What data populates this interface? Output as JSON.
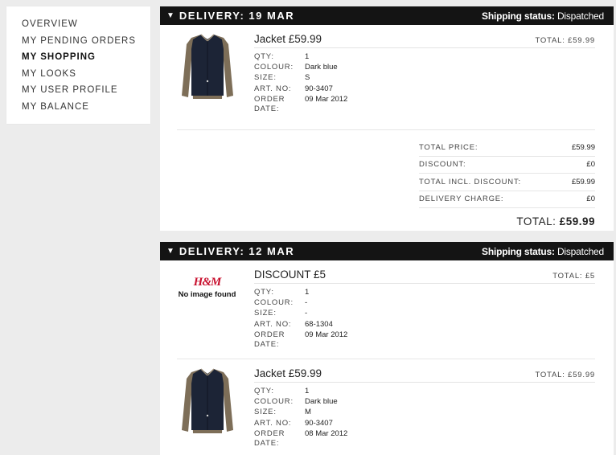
{
  "sidebar": {
    "items": [
      {
        "label": "OVERVIEW"
      },
      {
        "label": "MY PENDING ORDERS"
      },
      {
        "label": "MY SHOPPING",
        "active": true
      },
      {
        "label": "MY LOOKS"
      },
      {
        "label": "MY USER PROFILE"
      },
      {
        "label": "MY BALANCE"
      }
    ]
  },
  "labels": {
    "qty": "QTY:",
    "colour": "COLOUR:",
    "size": "SIZE:",
    "art_no": "ART. NO:",
    "order_date": "ORDER DATE:",
    "total": "TOTAL:",
    "shipping_status": "Shipping status:",
    "no_image": "No image found",
    "logo_text": "H&M"
  },
  "deliveries": [
    {
      "title": "DELIVERY: 19 MAR",
      "status": "Dispatched",
      "items": [
        {
          "name": "Jacket £59.99",
          "total": "£59.99",
          "qty": "1",
          "colour": "Dark blue",
          "size": "S",
          "art_no": "90-3407",
          "order_date": "09 Mar 2012"
        }
      ],
      "summary": [
        {
          "label": "TOTAL PRICE:",
          "value": "£59.99"
        },
        {
          "label": "DISCOUNT:",
          "value": "£0"
        },
        {
          "label": "TOTAL INCL. DISCOUNT:",
          "value": "£59.99"
        },
        {
          "label": "DELIVERY CHARGE:",
          "value": "£0"
        }
      ],
      "grand_total_label": "TOTAL:",
      "grand_total": "£59.99"
    },
    {
      "title": "DELIVERY: 12 MAR",
      "status": "Dispatched",
      "items": [
        {
          "name": "DISCOUNT £5",
          "total": "£5",
          "qty": "1",
          "colour": "-",
          "size": "-",
          "art_no": "68-1304",
          "order_date": "09 Mar 2012"
        },
        {
          "name": "Jacket £59.99",
          "total": "£59.99",
          "qty": "1",
          "colour": "Dark blue",
          "size": "M",
          "art_no": "90-3407",
          "order_date": "08 Mar 2012"
        }
      ]
    }
  ],
  "colors": {
    "header_bg": "#141414",
    "logo_red": "#c8102e",
    "page_bg": "#ececec"
  },
  "icons": {
    "collapse": "triangle-down-icon",
    "product": "jacket-icon"
  }
}
